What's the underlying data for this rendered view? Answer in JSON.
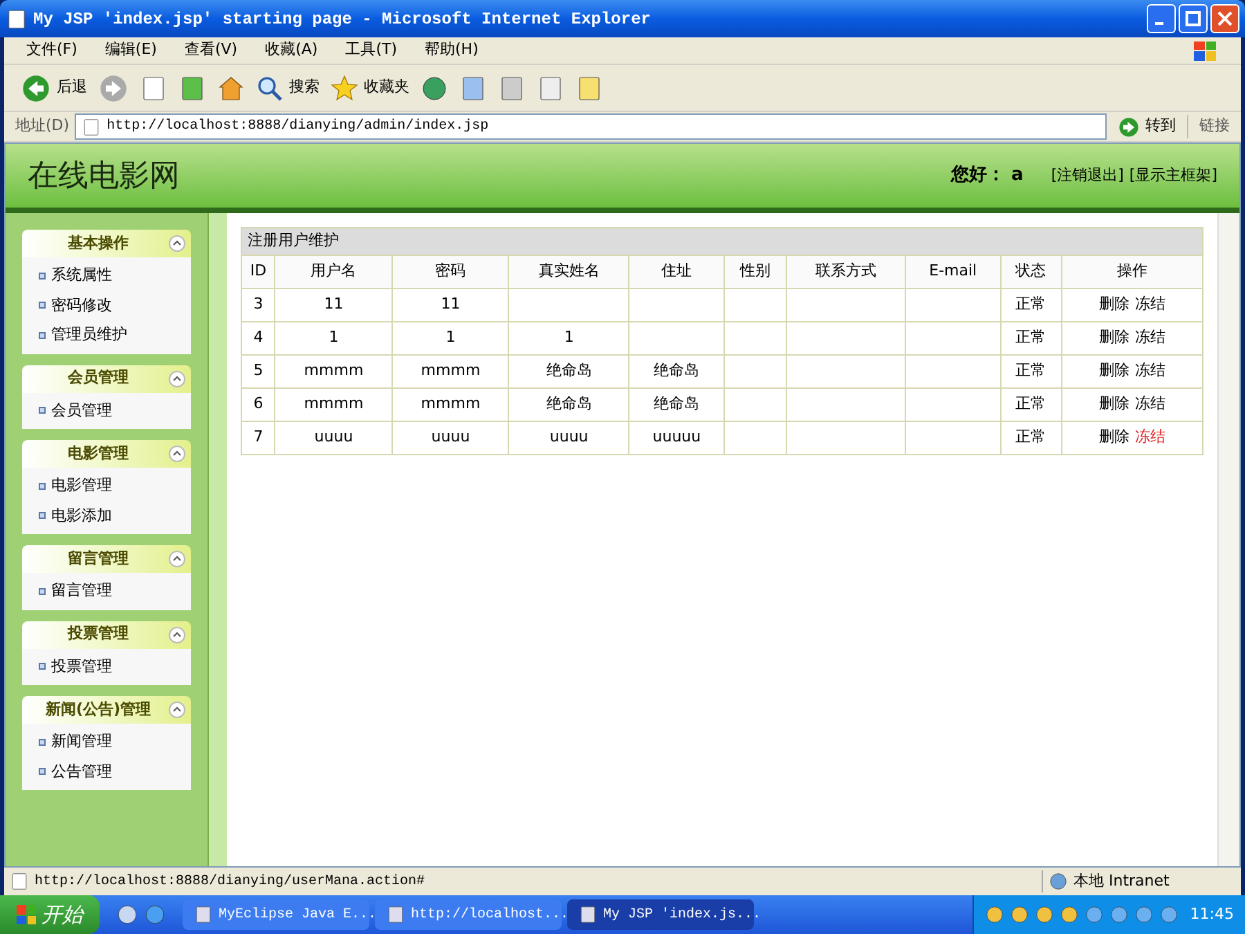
{
  "window": {
    "title": "My JSP 'index.jsp' starting page - Microsoft Internet Explorer"
  },
  "menu": [
    "文件(F)",
    "编辑(E)",
    "查看(V)",
    "收藏(A)",
    "工具(T)",
    "帮助(H)"
  ],
  "toolbar": {
    "back": "后退",
    "search": "搜索",
    "favorites": "收藏夹"
  },
  "address": {
    "label": "地址(D)",
    "value": "http://localhost:8888/dianying/admin/index.jsp",
    "go": "转到",
    "links": "链接"
  },
  "site": {
    "title": "在线电影网",
    "greeting": "您好：",
    "user": "a",
    "links": [
      "[注销退出]",
      "[显示主框架]"
    ]
  },
  "sidebar": [
    {
      "title": "基本操作",
      "expanded": true,
      "items": [
        "系统属性",
        "密码修改",
        "管理员维护"
      ]
    },
    {
      "title": "会员管理",
      "expanded": true,
      "items": [
        "会员管理"
      ]
    },
    {
      "title": "电影管理",
      "expanded": true,
      "items": [
        "电影管理",
        "电影添加"
      ]
    },
    {
      "title": "留言管理",
      "expanded": true,
      "items": [
        "留言管理"
      ]
    },
    {
      "title": "投票管理",
      "expanded": true,
      "items": [
        "投票管理"
      ]
    },
    {
      "title": "新闻(公告)管理",
      "expanded": true,
      "items": [
        "新闻管理",
        "公告管理"
      ]
    }
  ],
  "table": {
    "caption": "注册用户维护",
    "columns": [
      "ID",
      "用户名",
      "密码",
      "真实姓名",
      "住址",
      "性别",
      "联系方式",
      "E-mail",
      "状态",
      "操作"
    ],
    "rows": [
      {
        "cells": [
          "3",
          "11",
          "11",
          "",
          "",
          "",
          "",
          "",
          "正常"
        ],
        "actions": [
          {
            "label": "删除",
            "highlighted": false
          },
          {
            "label": "冻结",
            "highlighted": false
          }
        ]
      },
      {
        "cells": [
          "4",
          "1",
          "1",
          "1",
          "",
          "",
          "",
          "",
          "正常"
        ],
        "actions": [
          {
            "label": "删除",
            "highlighted": false
          },
          {
            "label": "冻结",
            "highlighted": false
          }
        ]
      },
      {
        "cells": [
          "5",
          "mmmm",
          "mmmm",
          "绝命岛",
          "绝命岛",
          "",
          "",
          "",
          "正常"
        ],
        "actions": [
          {
            "label": "删除",
            "highlighted": false
          },
          {
            "label": "冻结",
            "highlighted": false
          }
        ]
      },
      {
        "cells": [
          "6",
          "mmmm",
          "mmmm",
          "绝命岛",
          "绝命岛",
          "",
          "",
          "",
          "正常"
        ],
        "actions": [
          {
            "label": "删除",
            "highlighted": false
          },
          {
            "label": "冻结",
            "highlighted": false
          }
        ]
      },
      {
        "cells": [
          "7",
          "uuuu",
          "uuuu",
          "uuuu",
          "uuuuu",
          "",
          "",
          "",
          "正常"
        ],
        "actions": [
          {
            "label": "删除",
            "highlighted": false
          },
          {
            "label": "冻结",
            "highlighted": true
          }
        ]
      }
    ]
  },
  "status_bar": {
    "url": "http://localhost:8888/dianying/userMana.action#",
    "zone": "本地 Intranet"
  },
  "taskbar": {
    "start": "开始",
    "tasks": [
      {
        "label": "MyEclipse Java E...",
        "selected": false
      },
      {
        "label": "http://localhost...",
        "selected": false
      },
      {
        "label": "My JSP 'index.js...",
        "selected": true
      }
    ],
    "clock": "11:45"
  }
}
